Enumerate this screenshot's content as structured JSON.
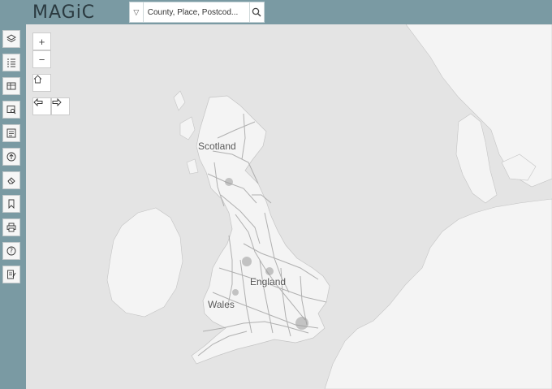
{
  "header": {
    "logo_text": "MAGiC",
    "search": {
      "placeholder": "County, Place, Postcod..."
    }
  },
  "sidebar": {
    "items": [
      {
        "icon": "layers-icon"
      },
      {
        "icon": "legend-list-icon"
      },
      {
        "icon": "table-icon"
      },
      {
        "icon": "map-search-icon"
      },
      {
        "icon": "identify-icon"
      },
      {
        "icon": "upload-icon"
      },
      {
        "icon": "eraser-icon"
      },
      {
        "icon": "bookmark-icon"
      },
      {
        "icon": "print-icon"
      },
      {
        "icon": "help-icon"
      },
      {
        "icon": "notes-icon"
      }
    ]
  },
  "map_controls": {
    "zoom_in": "+",
    "zoom_out": "−",
    "home_icon": "home-icon",
    "back_icon": "arrow-left-icon",
    "forward_icon": "arrow-right-icon"
  },
  "map_labels": {
    "scotland": "Scotland",
    "england": "England",
    "wales": "Wales"
  },
  "colors": {
    "chrome": "#7a9aa3",
    "sea": "#e4e4e4",
    "land": "#f4f4f4",
    "roads": "#a9a9a9"
  }
}
